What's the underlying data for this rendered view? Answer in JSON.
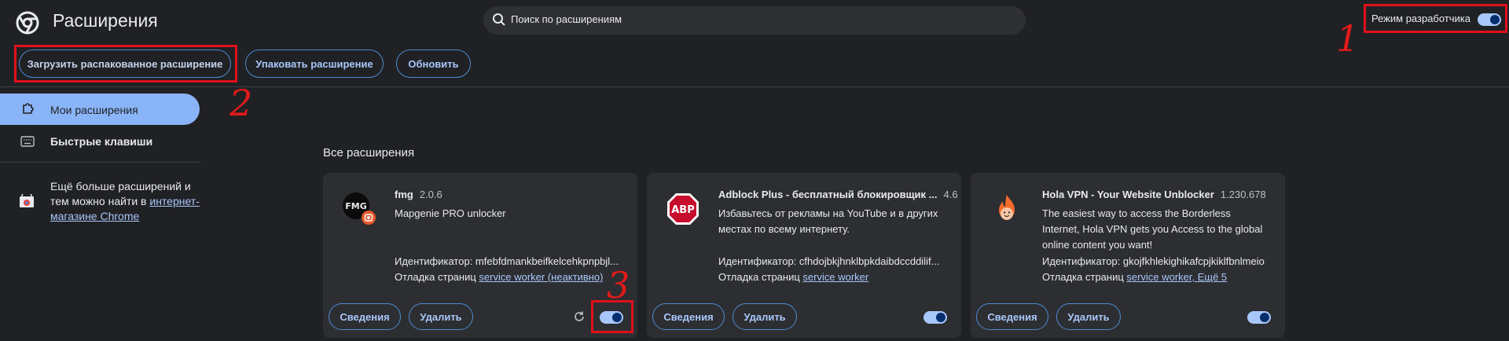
{
  "header": {
    "title": "Расширения",
    "search_placeholder": "Поиск по расширениям",
    "dev_mode_label": "Режим разработчика",
    "dev_mode_on": true
  },
  "toolbar": {
    "load_unpacked": "Загрузить распакованное расширение",
    "pack": "Упаковать расширение",
    "update": "Обновить"
  },
  "sidebar": {
    "items": [
      {
        "label": "Мои расширения",
        "icon": "puzzle-icon",
        "active": true
      },
      {
        "label": "Быстрые клавиши",
        "icon": "keyboard-icon",
        "active": false
      }
    ],
    "webstore_text": "Ещё больше расширений и тем можно найти в",
    "webstore_link": "интернет-магазине Chrome"
  },
  "main": {
    "section_title": "Все расширения",
    "cards": [
      {
        "name": "fmg",
        "version": "2.0.6",
        "description": "Mapgenie PRO unlocker",
        "id_line": "Идентификатор: mfebfdmankbeifkelcehkpnpbjl...",
        "debug_label": "Отладка страниц",
        "debug_link": "service worker (неактивно)",
        "details": "Сведения",
        "remove": "Удалить",
        "enabled": true,
        "icon": "fmg-icon"
      },
      {
        "name": "Adblock Plus - бесплатный блокировщик ...",
        "version": "4.6",
        "description": "Избавьтесь от рекламы на YouTube и в других местах по всему интернету.",
        "id_line": "Идентификатор: cfhdojbkjhnklbpkdaibdccddilif...",
        "debug_label": "Отладка страниц",
        "debug_link": "service worker",
        "details": "Сведения",
        "remove": "Удалить",
        "enabled": true,
        "icon": "abp-icon",
        "icon_text": "ABP"
      },
      {
        "name": "Hola VPN - Your Website Unblocker",
        "version": "1.230.678",
        "description": "The easiest way to access the Borderless Internet, Hola VPN gets you Access to the global online content you want!",
        "id_line": "Идентификатор: gkojfkhlekighikafcpjkiklfbnlmeio",
        "debug_label": "Отладка страниц",
        "debug_link": "service worker, Ещё 5",
        "details": "Сведения",
        "remove": "Удалить",
        "enabled": true,
        "icon": "hola-icon"
      }
    ]
  },
  "annotations": [
    "1",
    "2",
    "3"
  ],
  "colors": {
    "accent": "#a8c7fa",
    "annotation": "#e0101c",
    "background": "#202124",
    "card": "#2d2e31"
  }
}
